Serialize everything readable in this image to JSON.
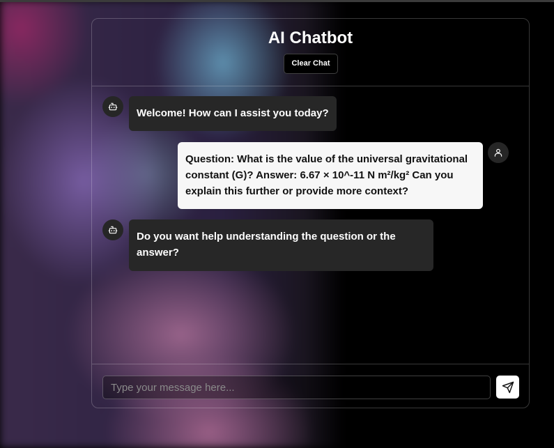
{
  "header": {
    "title": "AI Chatbot",
    "clear_label": "Clear Chat"
  },
  "messages": [
    {
      "role": "bot",
      "avatar_icon": "robot-icon",
      "text": "Welcome! How can I assist you today?"
    },
    {
      "role": "user",
      "avatar_icon": "user-icon",
      "text": "Question: What is the value of the universal gravitational constant (G)? Answer: 6.67 × 10^-11 N m²/kg² Can you explain this further or provide more context?"
    },
    {
      "role": "bot",
      "avatar_icon": "robot-icon",
      "text": "Do you want help understanding the question or the answer?"
    }
  ],
  "composer": {
    "placeholder": "Type your message here...",
    "value": "",
    "send_icon": "send-icon"
  },
  "colors": {
    "bot_bubble": "#272727",
    "user_bubble": "#f7f7f7",
    "panel_border": "rgba(255,255,255,0.22)"
  }
}
